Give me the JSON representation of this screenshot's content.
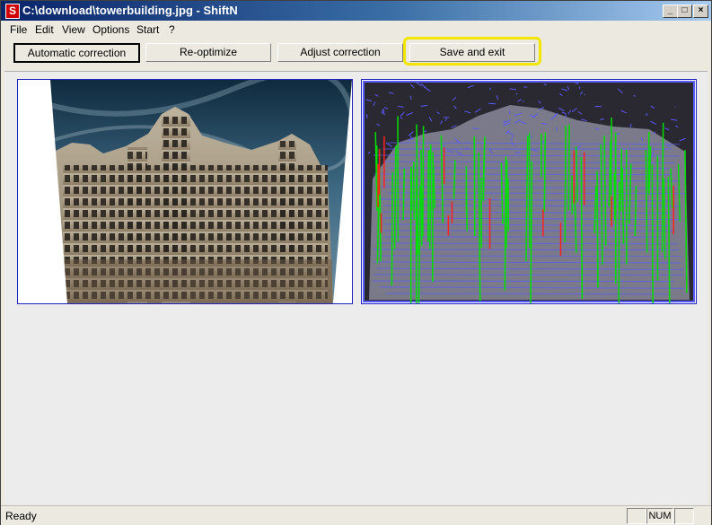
{
  "window": {
    "title": "C:\\download\\towerbuilding.jpg - ShiftN",
    "app_icon_letter": "S",
    "controls": {
      "minimize": "_",
      "maximize": "□",
      "close": "×"
    }
  },
  "menu": {
    "items": [
      "File",
      "Edit",
      "View",
      "Options",
      "Start",
      "?"
    ]
  },
  "toolbar": {
    "buttons": [
      "Automatic correction",
      "Re-optimize",
      "Adjust correction",
      "Save and exit"
    ]
  },
  "status": {
    "text": "Ready",
    "indicators": [
      "",
      "NUM",
      ""
    ]
  },
  "colors": {
    "highlight": "#f2e600",
    "panel_border": "#2020c0",
    "line_green": "#00e000",
    "line_blue": "#5a5aff",
    "line_red": "#ff2020"
  },
  "icons": {
    "image_left": "corrected-building-photo",
    "image_right": "edge-detection-lines"
  }
}
